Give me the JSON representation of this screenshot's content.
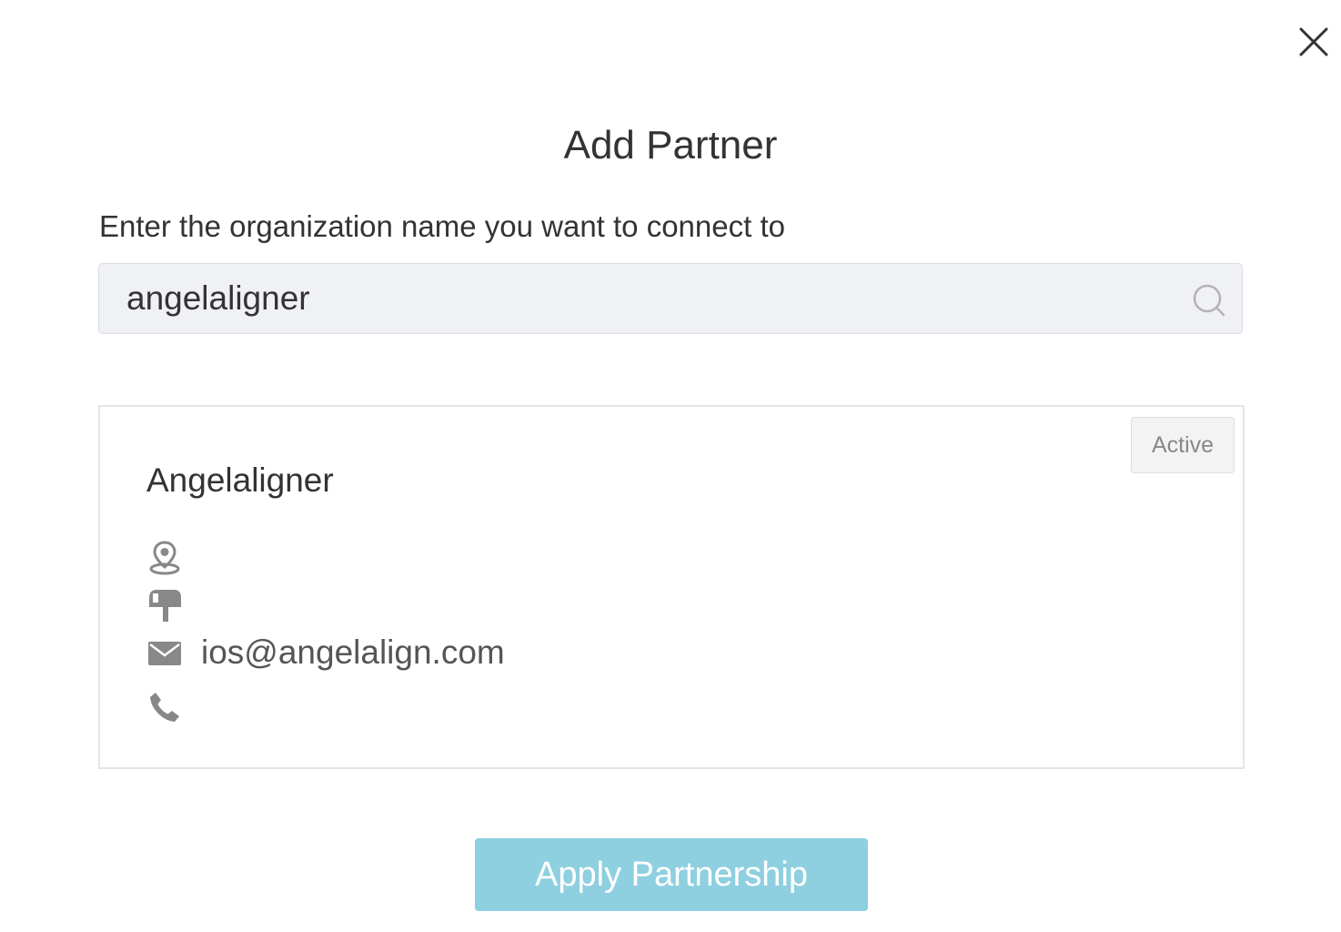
{
  "dialog": {
    "title": "Add Partner",
    "prompt": "Enter the organization name you want to connect to",
    "close_icon": "close-icon"
  },
  "search": {
    "value": "angelaligner",
    "icon": "search-icon"
  },
  "result": {
    "name": "Angelaligner",
    "status": "Active",
    "address": "",
    "mailbox": "",
    "email": "ios@angelalign.com",
    "phone": "",
    "icons": {
      "address": "location-pin-icon",
      "mailbox": "mailbox-icon",
      "email": "envelope-icon",
      "phone": "phone-icon"
    }
  },
  "actions": {
    "apply_label": "Apply Partnership"
  },
  "colors": {
    "button_bg": "#8ecfe0",
    "input_bg": "#f0f1f5",
    "icon_gray": "#888888",
    "text": "#333333"
  }
}
